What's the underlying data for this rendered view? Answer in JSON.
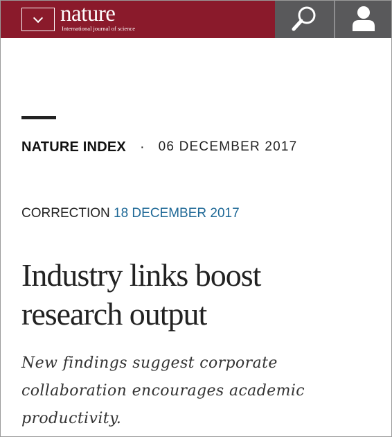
{
  "header": {
    "logo_word": "nature",
    "logo_tagline": "International journal of science",
    "brand_color": "#8a1a2b",
    "icon_bg_color": "#59595b",
    "menu_icon": "chevron-down-icon",
    "search_icon": "search-icon",
    "account_icon": "user-icon"
  },
  "article": {
    "section": "NATURE INDEX",
    "separator": "·",
    "published_date": "06 DECEMBER 2017",
    "correction_label": "CORRECTION",
    "correction_date": "18 DECEMBER 2017",
    "correction_link_color": "#1e6896",
    "title": "Industry links boost research output",
    "standfirst": "New findings suggest corporate collaboration encourages academic productivity."
  }
}
